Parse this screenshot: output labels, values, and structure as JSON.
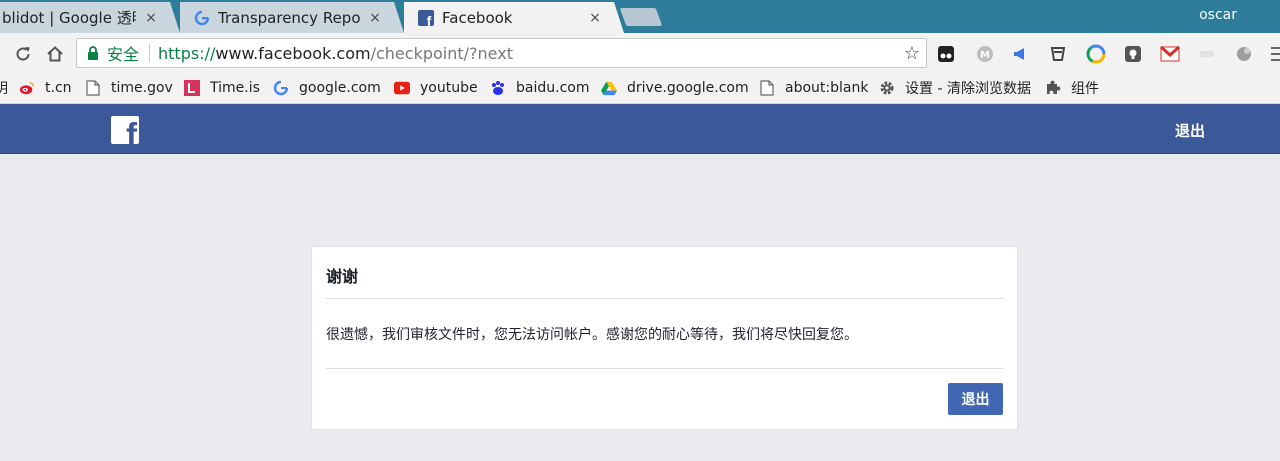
{
  "browser": {
    "tabs": [
      {
        "title": "blidot | Google 透明度",
        "favicon": "document-icon"
      },
      {
        "title": "Transparency Report",
        "favicon": "google-g-icon"
      },
      {
        "title": "Facebook",
        "favicon": "facebook-icon"
      }
    ],
    "active_tab": 2,
    "close_glyph": "×",
    "profile_name": "oscar",
    "toolbar": {
      "security_label": "安全",
      "url_scheme": "https://",
      "url_host": "www.facebook.com",
      "url_path": "/checkpoint/?next"
    },
    "bookmarks": [
      {
        "label": "t.cn",
        "icon": "weibo-icon"
      },
      {
        "label": "time.gov",
        "icon": "document-icon"
      },
      {
        "label": "Time.is",
        "icon": "time-is-icon"
      },
      {
        "label": "google.com",
        "icon": "google-g-icon"
      },
      {
        "label": "youtube",
        "icon": "youtube-icon"
      },
      {
        "label": "baidu.com",
        "icon": "baidu-icon"
      },
      {
        "label": "drive.google.com",
        "icon": "google-drive-icon"
      },
      {
        "label": "about:blank",
        "icon": "document-icon"
      },
      {
        "label": "设置 - 清除浏览数据",
        "icon": "gear-icon"
      },
      {
        "label": "组件",
        "icon": "puzzle-icon"
      }
    ],
    "bookmark_overflow_text": "明"
  },
  "facebook": {
    "header_logout": "退出",
    "card": {
      "title": "谢谢",
      "message": "很遗憾，我们审核文件时，您无法访问帐户。感谢您的耐心等待，我们将尽快回复您。",
      "button": "退出"
    }
  },
  "colors": {
    "tabstrip": "#2c7c9a",
    "facebook_blue": "#3b5998",
    "button_blue": "#4267b2",
    "secure_green": "#0b8043",
    "page_bg": "#e9ebee"
  }
}
